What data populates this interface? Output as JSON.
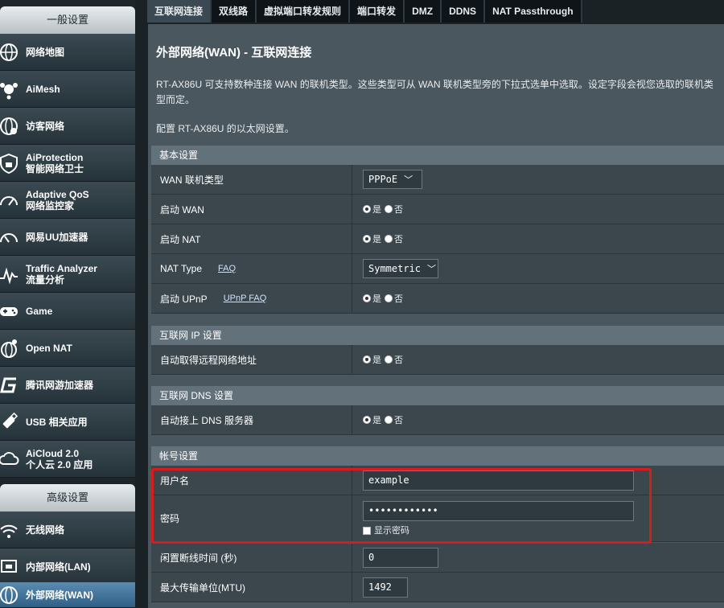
{
  "sidebar": {
    "general_header": "一般设置",
    "advanced_header": "高级设置",
    "items": [
      {
        "label": "网络地图",
        "label2": "",
        "icon": "globe-network-icon"
      },
      {
        "label": "AiMesh",
        "label2": "",
        "icon": "mesh-icon"
      },
      {
        "label": "访客网络",
        "label2": "",
        "icon": "guest-network-icon"
      },
      {
        "label": "AiProtection",
        "label2": "智能网络卫士",
        "icon": "shield-lock-icon"
      },
      {
        "label": "Adaptive QoS",
        "label2": "网络监控家",
        "icon": "speedometer-icon"
      },
      {
        "label": "网易UU加速器",
        "label2": "",
        "icon": "uu-accelerator-icon"
      },
      {
        "label": "Traffic Analyzer",
        "label2": "流量分析",
        "icon": "traffic-chart-icon"
      },
      {
        "label": "Game",
        "label2": "",
        "icon": "gamepad-icon"
      },
      {
        "label": "Open NAT",
        "label2": "",
        "icon": "open-nat-icon"
      },
      {
        "label": "腾讯网游加速器",
        "label2": "",
        "icon": "tencent-g-icon"
      },
      {
        "label": "USB 相关应用",
        "label2": "",
        "icon": "usb-icon"
      },
      {
        "label": "AiCloud 2.0",
        "label2": "个人云 2.0 应用",
        "icon": "cloud-icon"
      }
    ],
    "advanced_items": [
      {
        "label": "无线网络",
        "icon": "wifi-icon"
      },
      {
        "label": "内部网络(LAN)",
        "icon": "lan-icon"
      },
      {
        "label": "外部网络(WAN)",
        "icon": "wan-globe-icon"
      }
    ]
  },
  "tabs": [
    "互联网连接",
    "双线路",
    "虚拟端口转发规则",
    "端口转发",
    "DMZ",
    "DDNS",
    "NAT Passthrough"
  ],
  "page": {
    "title": "外部网络(WAN) - 互联网连接",
    "desc": "RT-AX86U 可支持数种连接 WAN 的联机类型。这些类型可从 WAN 联机类型旁的下拉式选单中选取。设定字段会视您选取的联机类型而定。",
    "desc2": "配置 RT-AX86U 的以太网设置。"
  },
  "basic": {
    "header": "基本设置",
    "wan_type_label": "WAN 联机类型",
    "wan_type_value": "PPPoE",
    "enable_wan_label": "启动 WAN",
    "enable_nat_label": "启动 NAT",
    "nat_type_label": "NAT Type",
    "nat_type_faq": "FAQ",
    "nat_type_value": "Symmetric",
    "upnp_label": "启动 UPnP",
    "upnp_faq": "UPnP  FAQ",
    "yes": "是",
    "no": "否"
  },
  "ip": {
    "header": "互联网 IP 设置",
    "auto_ip_label": "自动取得远程网络地址"
  },
  "dns": {
    "header": "互联网 DNS 设置",
    "auto_dns_label": "自动接上 DNS 服务器"
  },
  "account": {
    "header": "帐号设置",
    "username_label": "用户名",
    "username_value": "example",
    "password_label": "密码",
    "password_value": "••••••••••••",
    "show_password": "显示密码",
    "idle_label": "闲置断线时间 (秒)",
    "idle_value": "0",
    "mtu_label": "最大传输单位(MTU)",
    "mtu_value": "1492"
  },
  "colors": {
    "highlight": "#d81b1b",
    "active_nav": "#2f5f86"
  }
}
